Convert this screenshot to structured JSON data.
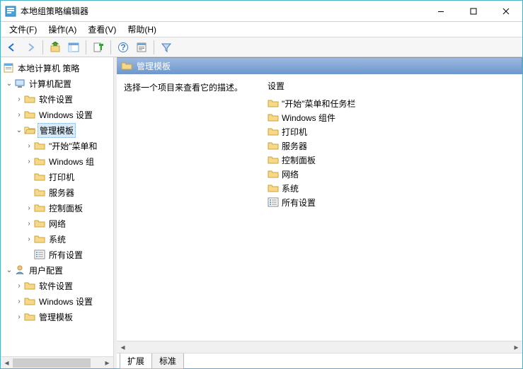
{
  "window": {
    "title": "本地组策略编辑器"
  },
  "menu": {
    "file": "文件(F)",
    "action": "操作(A)",
    "view": "查看(V)",
    "help": "帮助(H)"
  },
  "tree": {
    "root": "本地计算机 策略",
    "computer": "计算机配置",
    "computer_items": {
      "software": "软件设置",
      "windows": "Windows 设置",
      "templates": "管理模板",
      "tmpl_children": {
        "start": "\"开始\"菜单和",
        "components": "Windows 组",
        "printers": "打印机",
        "servers": "服务器",
        "cpanel": "控制面板",
        "network": "网络",
        "system": "系统",
        "all": "所有设置"
      }
    },
    "user": "用户配置",
    "user_items": {
      "software": "软件设置",
      "windows": "Windows 设置",
      "templates": "管理模板"
    }
  },
  "detail": {
    "header": "管理模板",
    "description": "选择一个项目来查看它的描述。",
    "column_header": "设置",
    "items": {
      "start": "\"开始\"菜单和任务栏",
      "components": "Windows 组件",
      "printers": "打印机",
      "servers": "服务器",
      "cpanel": "控制面板",
      "network": "网络",
      "system": "系统",
      "all": "所有设置"
    }
  },
  "tabs": {
    "extended": "扩展",
    "standard": "标准"
  }
}
